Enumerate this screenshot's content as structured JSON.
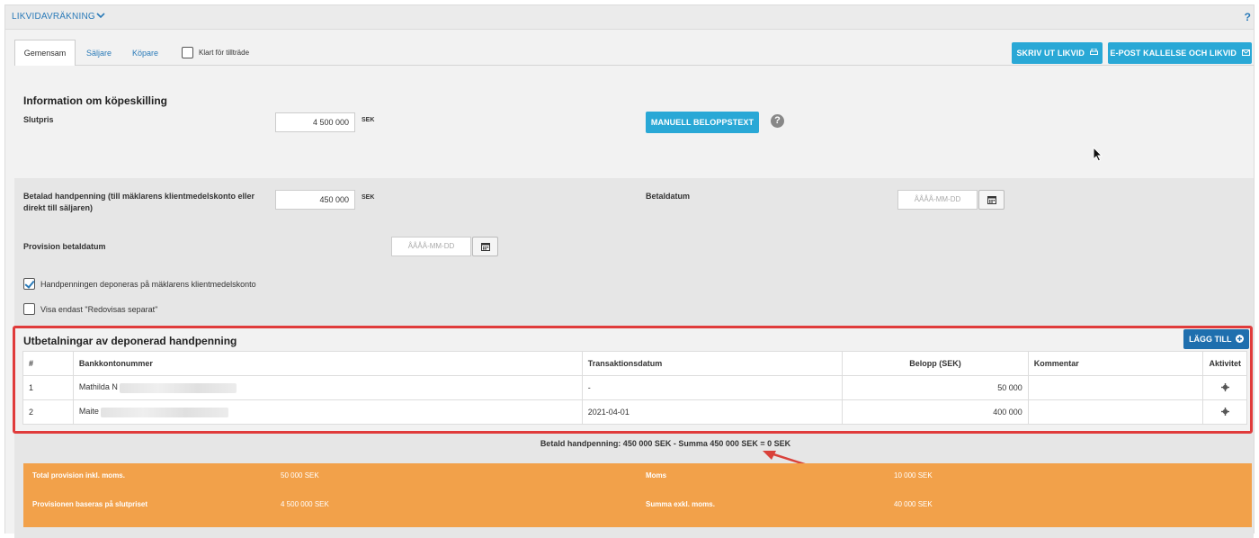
{
  "header": {
    "title": "LIKVIDAVRÄKNING",
    "help": "?"
  },
  "tabs": {
    "common": "Gemensam",
    "seller": "Säljare",
    "buyer": "Köpare",
    "ready_label": "Klart för tillträde"
  },
  "actions": {
    "print": "SKRIV UT LIKVID",
    "email": "E-POST KALLELSE OCH LIKVID"
  },
  "purchase_info": {
    "title": "Information om köpeskilling",
    "final_price_label": "Slutpris",
    "final_price_value": "4 500 000",
    "currency": "SEK",
    "manual_btn": "MANUELL BELOPPSTEXT",
    "help": "?"
  },
  "deposit": {
    "paid_label": "Betalad handpenning (till mäklarens klientmedelskonto eller direkt till säljaren)",
    "paid_value": "450 000",
    "currency": "SEK",
    "pay_date_label": "Betaldatum",
    "pay_date_placeholder": "ÅÅÅÅ-MM-DD",
    "commission_date_label": "Provision betaldatum",
    "commission_date_placeholder": "ÅÅÅÅ-MM-DD",
    "deposit_checkbox_label": "Handpenningen deponeras på mäklarens klientmedelskonto",
    "deposit_checked": true,
    "show_separate_label": "Visa endast \"Redovisas separat\"",
    "show_separate_checked": false
  },
  "payouts": {
    "title": "Utbetalningar av deponerad handpenning",
    "add_btn": "LÄGG TILL",
    "columns": [
      "#",
      "Bankkontonummer",
      "Transaktionsdatum",
      "Belopp (SEK)",
      "Kommentar",
      "Aktivitet"
    ],
    "rows": [
      {
        "num": "1",
        "account": "Mathilda N",
        "date": "-",
        "amount": "50 000",
        "comment": ""
      },
      {
        "num": "2",
        "account": "Maite",
        "date": "2021-04-01",
        "amount": "400 000",
        "comment": ""
      }
    ],
    "summary": "Betald handpenning: 450 000 SEK - Summa 450 000 SEK = 0 SEK"
  },
  "commission": {
    "total_label": "Total provision inkl. moms.",
    "total_value": "50 000 SEK",
    "vat_label": "Moms",
    "vat_value": "10 000 SEK",
    "basis_label": "Provisionen baseras på slutpriset",
    "basis_value": "4 500 000 SEK",
    "excl_label": "Summa exkl. moms.",
    "excl_value": "40 000 SEK"
  },
  "colors": {
    "accent": "#29a8d6",
    "primary_dark": "#1f6fae",
    "highlight_red": "#e03b3b",
    "commission_orange": "#f2a14a"
  }
}
